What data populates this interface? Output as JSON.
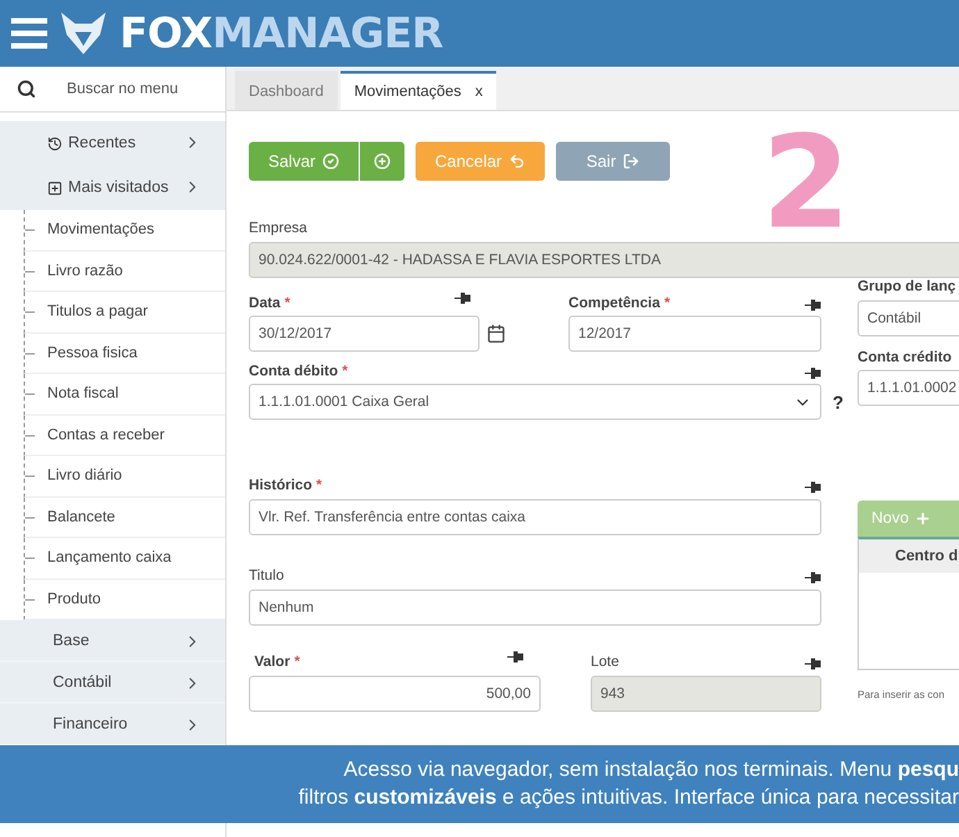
{
  "header": {
    "logo_first": "FOX",
    "logo_rest": "MANAGER"
  },
  "sidebar": {
    "search": {
      "placeholder": "Buscar no menu"
    },
    "items": [
      {
        "kind": "recent",
        "label": "Recentes"
      },
      {
        "kind": "favorites",
        "label": "Mais visitados"
      },
      {
        "kind": "link",
        "label": "Movimentações"
      },
      {
        "kind": "link",
        "label": "Livro razão"
      },
      {
        "kind": "link",
        "label": "Titulos a pagar"
      },
      {
        "kind": "link",
        "label": "Pessoa fisica"
      },
      {
        "kind": "link",
        "label": "Nota fiscal"
      },
      {
        "kind": "link",
        "label": "Contas a receber"
      },
      {
        "kind": "link",
        "label": "Livro diário"
      },
      {
        "kind": "link",
        "label": "Balancete"
      },
      {
        "kind": "link",
        "label": "Lançamento caixa"
      },
      {
        "kind": "link",
        "label": "Produto"
      },
      {
        "kind": "section",
        "label": "Base"
      },
      {
        "kind": "section",
        "label": "Contábil"
      },
      {
        "kind": "section",
        "label": "Financeiro"
      }
    ]
  },
  "tabs": [
    {
      "label": "Dashboard",
      "selected": false
    },
    {
      "label": "Movimentações",
      "selected": true,
      "close": "x"
    }
  ],
  "toolbar": [
    {
      "kind": "save",
      "label": "Salvar"
    },
    {
      "kind": "cancel",
      "label": "Cancelar"
    },
    {
      "kind": "exit",
      "label": "Sair"
    }
  ],
  "step_number": "2",
  "form": {
    "empresa": {
      "label": "Empresa",
      "value": "90.024.622/0001-42 - HADASSA E FLAVIA ESPORTES LTDA"
    },
    "data": {
      "label": "Data",
      "mark": "*",
      "value": "30/12/2017"
    },
    "competencia": {
      "label": "Competência",
      "mark": "*",
      "value": "12/2017"
    },
    "conta_debito": {
      "label": "Conta débito",
      "mark": "*",
      "value": "1.1.1.01.0001 Caixa Geral",
      "help": "?"
    },
    "historico": {
      "label": "Histórico",
      "mark": "*",
      "value": "Vlr. Ref. Transferência entre contas caixa"
    },
    "titulo": {
      "label": "Titulo",
      "value": "Nenhum"
    },
    "valor": {
      "label": "Valor",
      "mark": "*",
      "value": "500,00"
    },
    "lote": {
      "label": "Lote",
      "value": "943"
    },
    "grupo": {
      "label": "Grupo de lanç",
      "value": "Contábil"
    },
    "conta_credito": {
      "label": "Conta crédito",
      "value": "1.1.1.01.0002"
    },
    "novo_button": "Novo",
    "centro_header": "Centro d",
    "hint": "Para inserir as con"
  },
  "banner": {
    "lines": [
      "Acesso via navegador, sem instalação nos terminais. Menu **pesqu**",
      "filtros **customizáveis** e ações intuitivas. Interface única para necessitar"
    ]
  }
}
